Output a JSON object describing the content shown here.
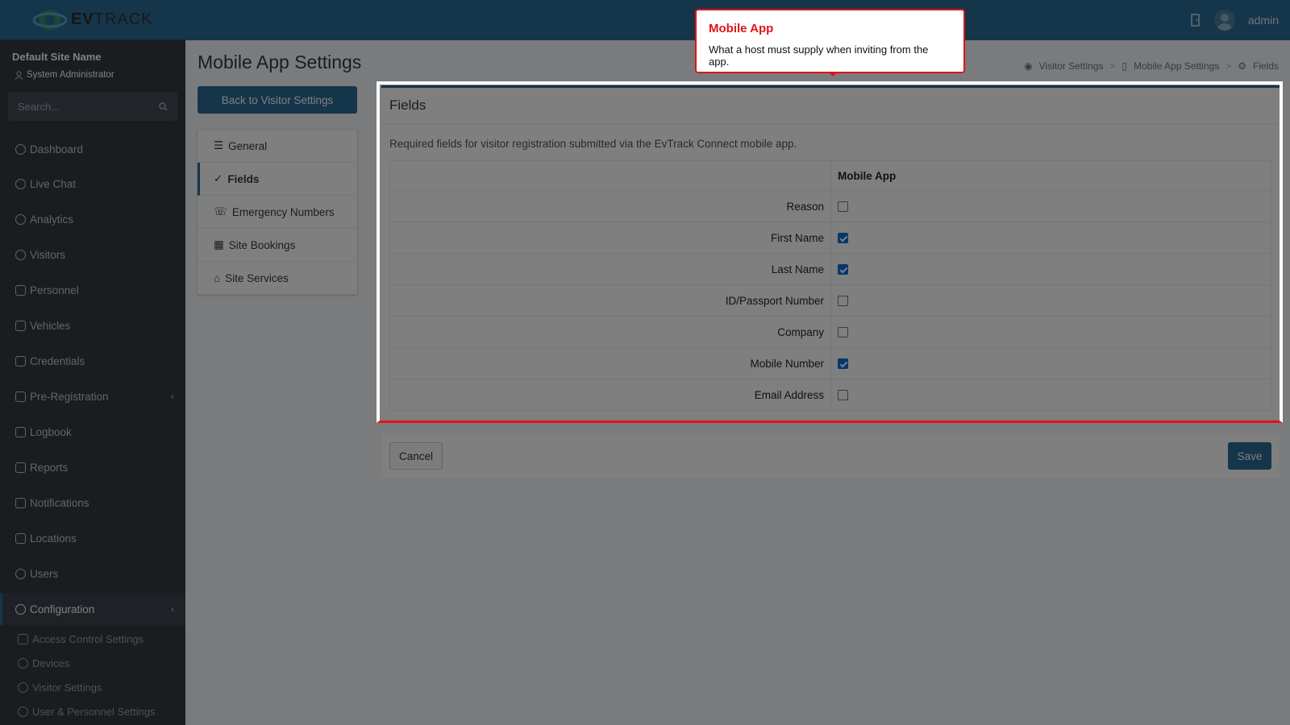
{
  "brand": {
    "name_bold": "EV",
    "name_thin": "TRACK"
  },
  "topbar": {
    "user": "admin"
  },
  "sidebar": {
    "site_name": "Default Site Name",
    "role": "System Administrator",
    "search_placeholder": "Search...",
    "items": [
      {
        "label": "Dashboard"
      },
      {
        "label": "Live Chat"
      },
      {
        "label": "Analytics"
      },
      {
        "label": "Visitors"
      },
      {
        "label": "Personnel"
      },
      {
        "label": "Vehicles"
      },
      {
        "label": "Credentials"
      },
      {
        "label": "Pre-Registration"
      },
      {
        "label": "Logbook"
      },
      {
        "label": "Reports"
      },
      {
        "label": "Notifications"
      },
      {
        "label": "Locations"
      },
      {
        "label": "Users"
      },
      {
        "label": "Configuration"
      }
    ],
    "sub_items": [
      {
        "label": "Access Control Settings"
      },
      {
        "label": "Devices"
      },
      {
        "label": "Visitor Settings"
      },
      {
        "label": "User & Personnel Settings"
      }
    ]
  },
  "page": {
    "title": "Mobile App Settings",
    "back_button": "Back to Visitor Settings"
  },
  "breadcrumb": [
    "Visitor Settings",
    "Mobile App Settings",
    "Fields"
  ],
  "settings_nav": [
    {
      "label": "General"
    },
    {
      "label": "Fields"
    },
    {
      "label": "Emergency Numbers"
    },
    {
      "label": "Site Bookings"
    },
    {
      "label": "Site Services"
    }
  ],
  "card": {
    "title": "Fields",
    "description": "Required fields for visitor registration submitted via the EvTrack Connect mobile app.",
    "column_header": "Mobile App",
    "rows": [
      {
        "label": "Reason",
        "checked": false
      },
      {
        "label": "First Name",
        "checked": true
      },
      {
        "label": "Last Name",
        "checked": true
      },
      {
        "label": "ID/Passport Number",
        "checked": false
      },
      {
        "label": "Company",
        "checked": false
      },
      {
        "label": "Mobile Number",
        "checked": true
      },
      {
        "label": "Email Address",
        "checked": false
      }
    ]
  },
  "actions": {
    "cancel": "Cancel",
    "save": "Save"
  },
  "tour": {
    "title": "Mobile App",
    "body": "What a host must supply when inviting from the app."
  },
  "colors": {
    "primary": "#2a6a96",
    "sidebar": "#343a40",
    "tour_accent": "#e3121b"
  }
}
